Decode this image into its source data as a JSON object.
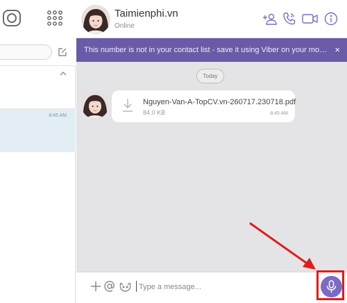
{
  "contact": {
    "name": "Taimienphi.vn",
    "status": "Online"
  },
  "banner": {
    "text": "This number is not in your contact list - save it using Viber on your mobile",
    "close": "×"
  },
  "messages": {
    "date_separator": "Today",
    "file": {
      "name": "Nguyen-Van-A-TopCV.vn-260717.230718.pdf",
      "size": "84.0 KB",
      "time": "8:45 AM"
    }
  },
  "chat_list": {
    "active_chat_time": "8:45 AM"
  },
  "input": {
    "placeholder": "Type a message..."
  },
  "colors": {
    "accent": "#7c6bc4",
    "banner": "#6b5aa8",
    "highlight": "#e21b1b",
    "active_chat": "#e2eef3"
  },
  "icons": {
    "header": [
      "add-contact-icon",
      "phone-icon",
      "video-icon",
      "info-icon"
    ],
    "input": [
      "plus-icon",
      "at-icon",
      "sticker-icon",
      "microphone-icon"
    ],
    "left": [
      "viber-logo-icon",
      "dialpad-icon",
      "compose-icon",
      "chevron-up-icon"
    ]
  }
}
